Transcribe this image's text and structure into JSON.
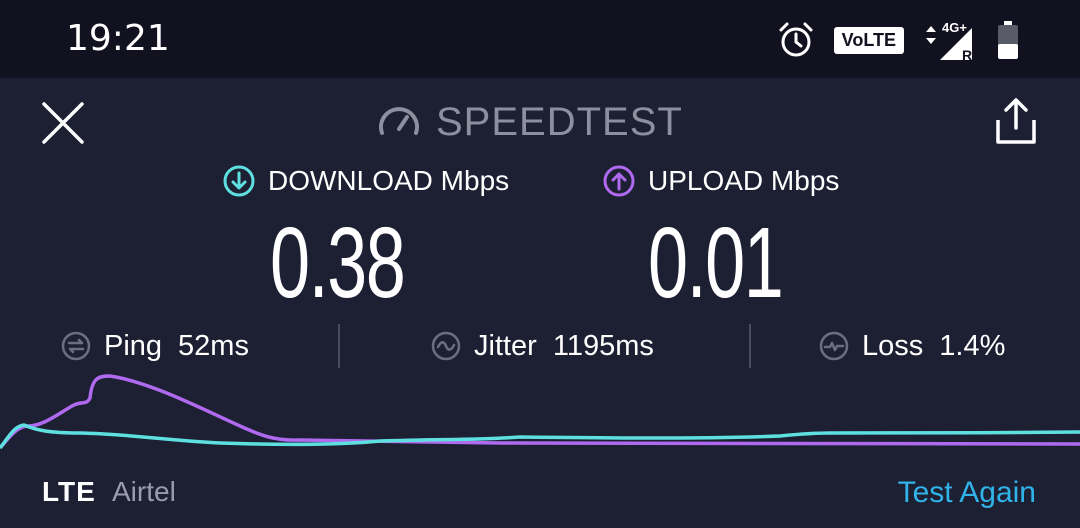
{
  "status_bar": {
    "time": "19:21",
    "volte_label": "VoLTE",
    "network_label": "4G+",
    "roaming_label": "R"
  },
  "header": {
    "title": "SPEEDTEST"
  },
  "download": {
    "label": "DOWNLOAD Mbps",
    "value": "0.38",
    "color": "#5ee0e0"
  },
  "upload": {
    "label": "UPLOAD Mbps",
    "value": "0.01",
    "color": "#b06af0"
  },
  "stats": {
    "ping_label": "Ping",
    "ping_value": "52ms",
    "jitter_label": "Jitter",
    "jitter_value": "1195ms",
    "loss_label": "Loss",
    "loss_value": "1.4%"
  },
  "footer": {
    "technology": "LTE",
    "carrier": "Airtel",
    "test_again_label": "Test Again"
  },
  "colors": {
    "background": "#1d1f33",
    "status_bar": "#111120",
    "accent": "#2fb3e8",
    "muted": "#8d8f9e"
  }
}
